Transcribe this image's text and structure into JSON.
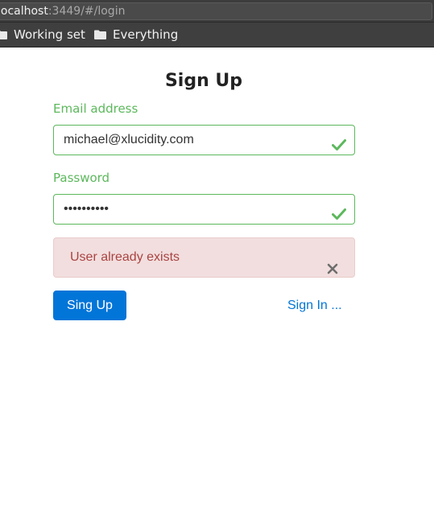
{
  "browser": {
    "url_host": "localhost",
    "url_rest": ":3449/#/login",
    "bookmarks": [
      {
        "label": "Working set",
        "icon": "folder-icon"
      },
      {
        "label": "Everything",
        "icon": "folder-icon"
      }
    ]
  },
  "form": {
    "title": "Sign Up",
    "email_label": "Email address",
    "email_value": "michael@xlucidity.com",
    "password_label": "Password",
    "password_value": "••••••••••",
    "error_message": "User already exists",
    "submit_label": "Sing Up",
    "signin_link": "Sign In ..."
  },
  "colors": {
    "success": "#5cb85c",
    "danger_text": "#a94442",
    "danger_bg": "#f2dede",
    "primary": "#0275d8"
  }
}
